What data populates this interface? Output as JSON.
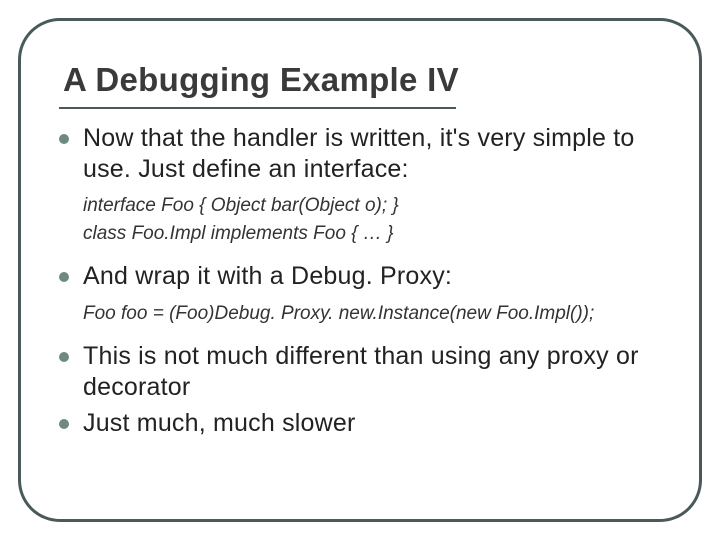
{
  "title": "A Debugging Example IV",
  "bullets": [
    {
      "text": "Now that the handler is written, it's very simple to use. Just define an interface:",
      "code": [
        "interface Foo { Object bar(Object o); }",
        "class Foo.Impl implements Foo { … }"
      ]
    },
    {
      "text": "And wrap it with a Debug. Proxy:",
      "code": [
        "Foo foo = (Foo)Debug. Proxy. new.Instance(new Foo.Impl());"
      ]
    },
    {
      "text": "This is not much different than using any proxy or decorator",
      "code": []
    },
    {
      "text": "Just much, much slower",
      "code": []
    }
  ]
}
